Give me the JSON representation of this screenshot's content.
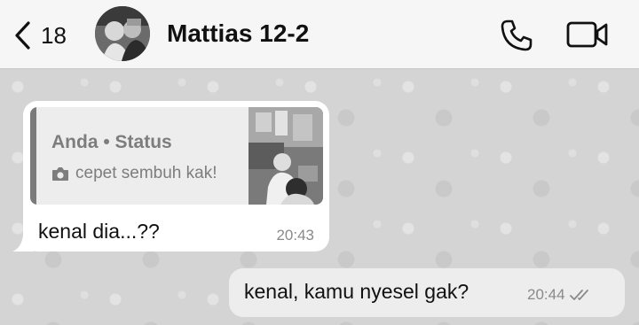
{
  "header": {
    "back_count": "18",
    "contact_name": "Mattias 12-2"
  },
  "incoming_message": {
    "quoted_author": "Anda • Status",
    "quoted_text": "cepet sembuh kak!",
    "text": "kenal dia...??",
    "time": "20:43"
  },
  "outgoing_message": {
    "text": "kenal, kamu nyesel gak?",
    "time": "20:44"
  },
  "icons": {
    "back": "chevron-left-icon",
    "call": "phone-icon",
    "video": "video-camera-icon",
    "quote_media": "camera-icon",
    "read_status": "double-check-icon"
  }
}
